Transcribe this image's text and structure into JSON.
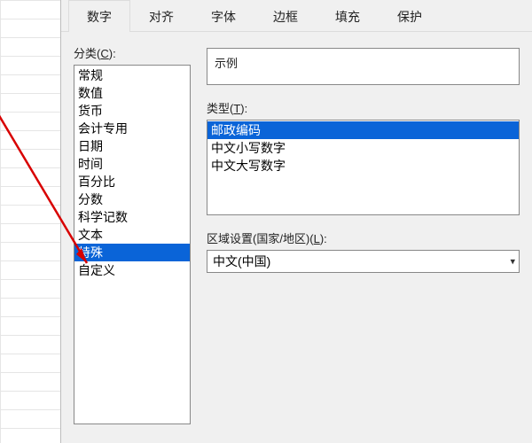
{
  "tabs": {
    "items": [
      "数字",
      "对齐",
      "字体",
      "边框",
      "填充",
      "保护"
    ],
    "active_index": 0
  },
  "category": {
    "label_prefix": "分类(",
    "label_key": "C",
    "label_suffix": "):",
    "items": [
      "常规",
      "数值",
      "货币",
      "会计专用",
      "日期",
      "时间",
      "百分比",
      "分数",
      "科学记数",
      "文本",
      "特殊",
      "自定义"
    ],
    "selected_index": 10
  },
  "sample": {
    "label": "示例",
    "value": ""
  },
  "type": {
    "label_prefix": "类型(",
    "label_key": "T",
    "label_suffix": "):",
    "items": [
      "邮政编码",
      "中文小写数字",
      "中文大写数字"
    ],
    "selected_index": 0
  },
  "locale": {
    "label_prefix": "区域设置(国家/地区)(",
    "label_key": "L",
    "label_suffix": "):",
    "value": "中文(中国)"
  },
  "annotation": {
    "arrow_color": "#d80000"
  }
}
